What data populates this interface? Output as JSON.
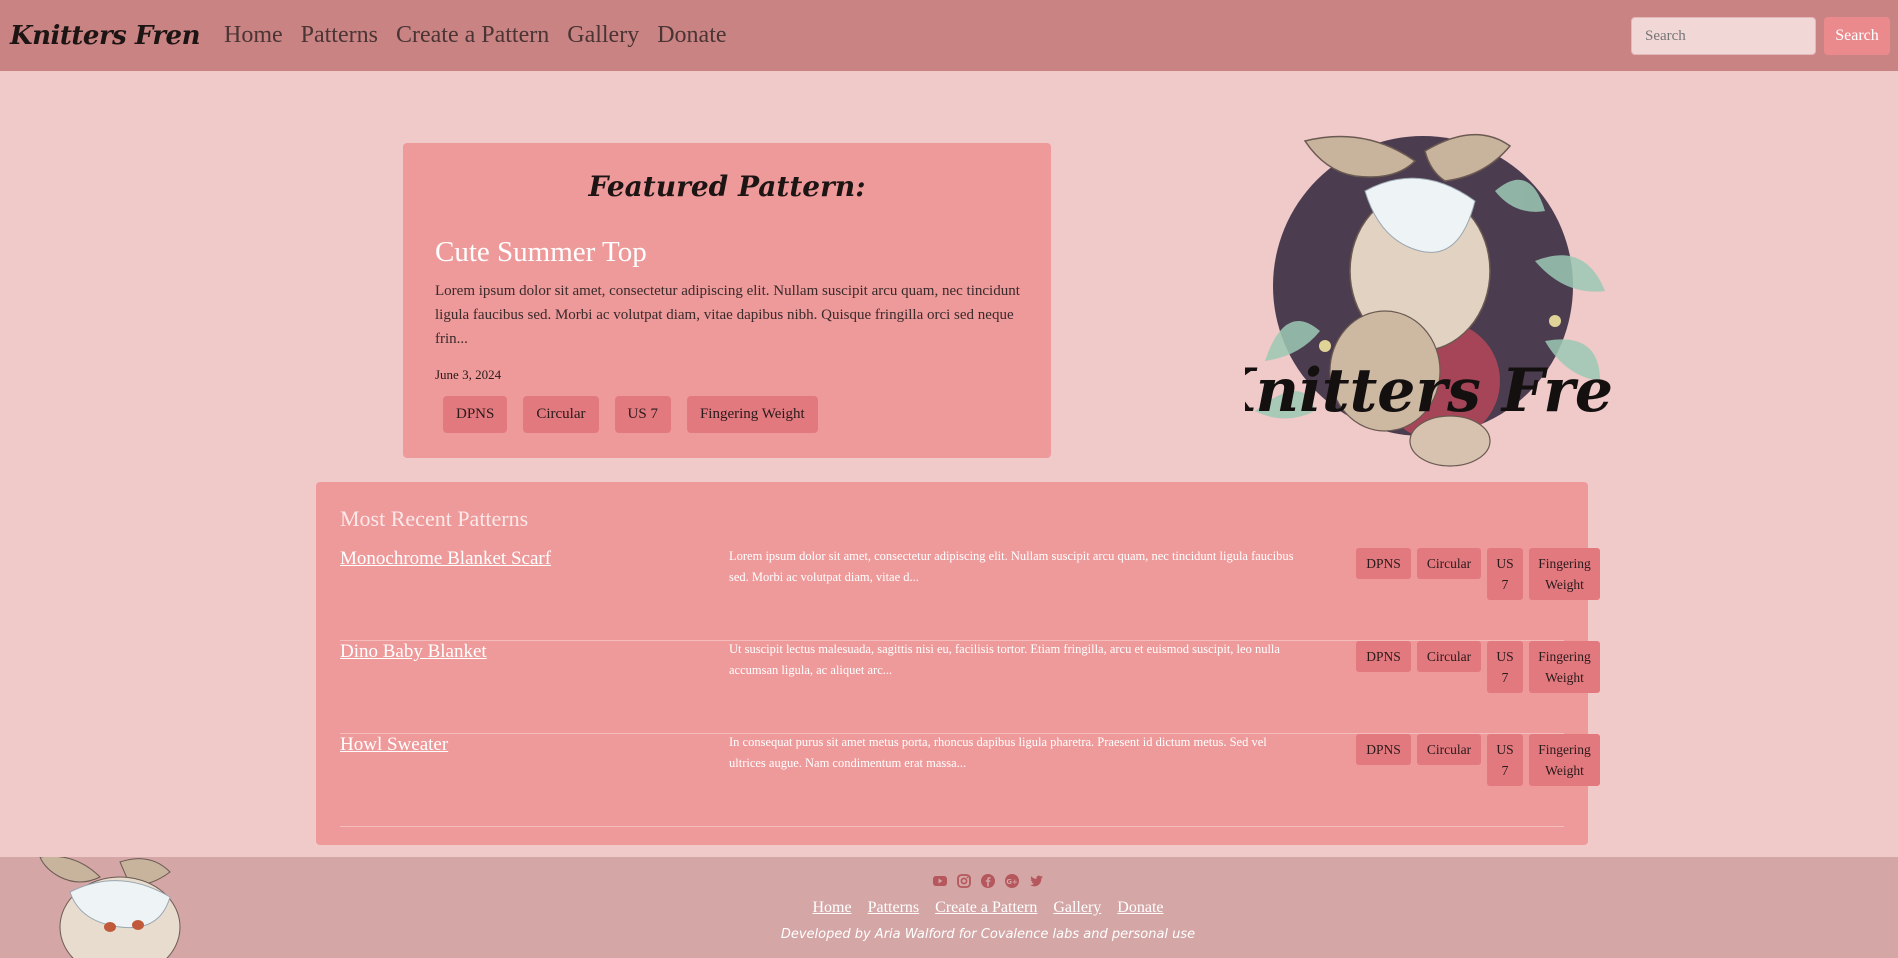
{
  "navbar": {
    "brand": "Knitters Fren",
    "links": [
      "Home",
      "Patterns",
      "Create a Pattern",
      "Gallery",
      "Donate"
    ],
    "search_placeholder": "Search",
    "search_button": "Search"
  },
  "featured": {
    "heading": "Featured Pattern:",
    "title": "Cute Summer Top",
    "description": "Lorem ipsum dolor sit amet, consectetur adipiscing elit. Nullam suscipit arcu quam, nec tincidunt ligula faucibus sed. Morbi ac volutpat diam, vitae dapibus nibh. Quisque fringilla orci sed neque frin...",
    "date": "June 3, 2024",
    "tags": [
      "DPNS",
      "Circular",
      "US 7",
      "Fingering Weight"
    ]
  },
  "logo_text": "Knitters Fren",
  "recent": {
    "heading": "Most Recent Patterns",
    "patterns": [
      {
        "title": "Monochrome Blanket Scarf",
        "description": "Lorem ipsum dolor sit amet, consectetur adipiscing elit. Nullam suscipit arcu quam, nec tincidunt ligula faucibus sed. Morbi ac volutpat diam, vitae d...",
        "tags": [
          "DPNS",
          "Circular",
          "US 7",
          "Fingering Weight"
        ]
      },
      {
        "title": "Dino Baby Blanket",
        "description": "Ut suscipit lectus malesuada, sagittis nisi eu, facilisis tortor. Etiam fringilla, arcu et euismod suscipit, leo nulla accumsan ligula, ac aliquet arc...",
        "tags": [
          "DPNS",
          "Circular",
          "US 7",
          "Fingering Weight"
        ]
      },
      {
        "title": "Howl Sweater",
        "description": "In consequat purus sit amet metus porta, rhoncus dapibus ligula pharetra. Praesent id dictum metus. Sed vel ultrices augue. Nam condimentum erat massa...",
        "tags": [
          "DPNS",
          "Circular",
          "US 7",
          "Fingering Weight"
        ]
      }
    ]
  },
  "footer": {
    "social_icons": [
      "youtube-icon",
      "instagram-icon",
      "facebook-icon",
      "google-plus-icon",
      "twitter-icon"
    ],
    "links": [
      "Home",
      "Patterns",
      "Create a Pattern",
      "Gallery",
      "Donate"
    ],
    "credit": "Developed by Aria Walford for Covalence labs and personal use"
  },
  "colors": {
    "page_bg": "#f0c9c9",
    "navbar_bg": "#c98383",
    "card_bg": "#ee9a9b",
    "tag_bg": "#e2797f",
    "footer_bg": "#d4a6a6",
    "accent": "#eb8a8d"
  }
}
